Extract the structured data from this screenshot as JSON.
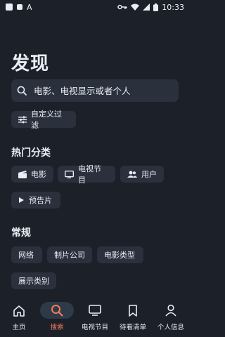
{
  "status_bar": {
    "time": "10:33"
  },
  "page": {
    "title": "发现"
  },
  "search": {
    "placeholder": "电影、电视显示或者个人"
  },
  "filter": {
    "label": "自定义过滤"
  },
  "popular": {
    "title": "热门分类",
    "chips": [
      {
        "label": "电影",
        "icon": "clapperboard-icon"
      },
      {
        "label": "电视节目",
        "icon": "tv-icon"
      },
      {
        "label": "用户",
        "icon": "users-icon"
      },
      {
        "label": "预告片",
        "icon": "play-icon"
      }
    ]
  },
  "general": {
    "title": "常规",
    "chips": [
      "网络",
      "制片公司",
      "电影类型",
      "展示类别"
    ]
  },
  "bottom_nav": {
    "items": [
      {
        "label": "主页",
        "icon": "home-icon"
      },
      {
        "label": "搜索",
        "icon": "search-icon",
        "active": true
      },
      {
        "label": "电视节目",
        "icon": "tv-icon"
      },
      {
        "label": "待看清单",
        "icon": "bookmark-icon"
      },
      {
        "label": "个人信息",
        "icon": "person-icon"
      }
    ],
    "accent": "#f07a5a"
  }
}
